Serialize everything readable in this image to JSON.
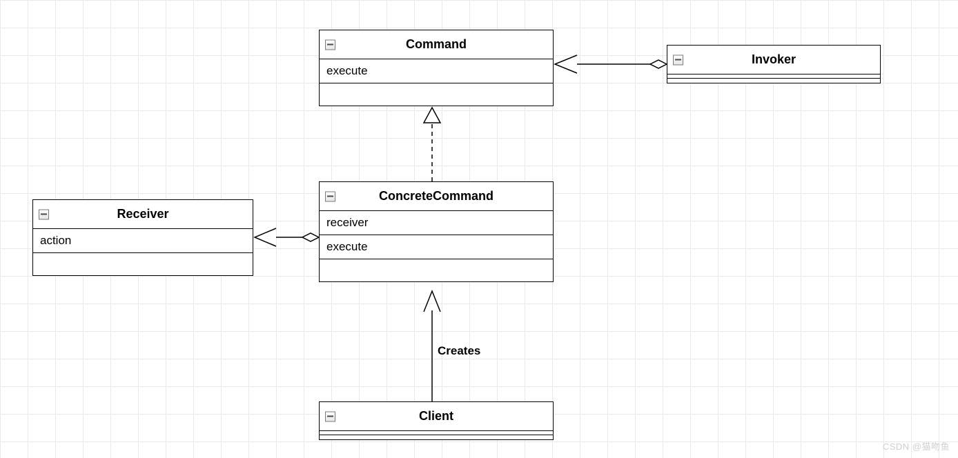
{
  "classes": {
    "command": {
      "name": "Command",
      "members": [
        "execute"
      ]
    },
    "invoker": {
      "name": "Invoker"
    },
    "concrete": {
      "name": "ConcreteCommand",
      "attrs": [
        "receiver"
      ],
      "ops": [
        "execute"
      ]
    },
    "receiver": {
      "name": "Receiver",
      "members": [
        "action"
      ]
    },
    "client": {
      "name": "Client"
    }
  },
  "edges": {
    "creates_label": "Creates"
  },
  "watermark": "CSDN @猫吻鱼"
}
